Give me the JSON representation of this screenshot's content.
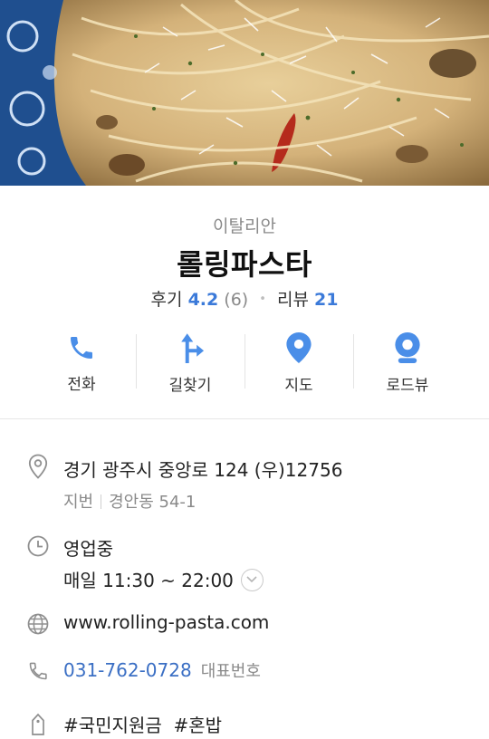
{
  "place": {
    "category": "이탈리안",
    "name": "롤링파스타",
    "rating_label": "후기",
    "rating_value": "4.2",
    "rating_count": "(6)",
    "review_label": "리뷰",
    "review_count": "21"
  },
  "actions": [
    {
      "label": "전화",
      "icon": "phone-icon"
    },
    {
      "label": "길찾기",
      "icon": "directions-icon"
    },
    {
      "label": "지도",
      "icon": "map-pin-icon"
    },
    {
      "label": "로드뷰",
      "icon": "roadview-icon"
    }
  ],
  "info": {
    "address": "경기 광주시 중앙로 124 (우)12756",
    "lot_label": "지번",
    "lot_address": "경안동 54-1",
    "status": "영업중",
    "hours": "매일 11:30 ~ 22:00",
    "website": "www.rolling-pasta.com",
    "phone": "031-762-0728",
    "phone_note": "대표번호",
    "tags": [
      "#국민지원금",
      "#혼밥"
    ]
  },
  "colors": {
    "accent_blue": "#3b7ad9",
    "icon_blue": "#4a8ee8",
    "open_green": "#3fa05c",
    "link_blue": "#3b6fc4"
  }
}
